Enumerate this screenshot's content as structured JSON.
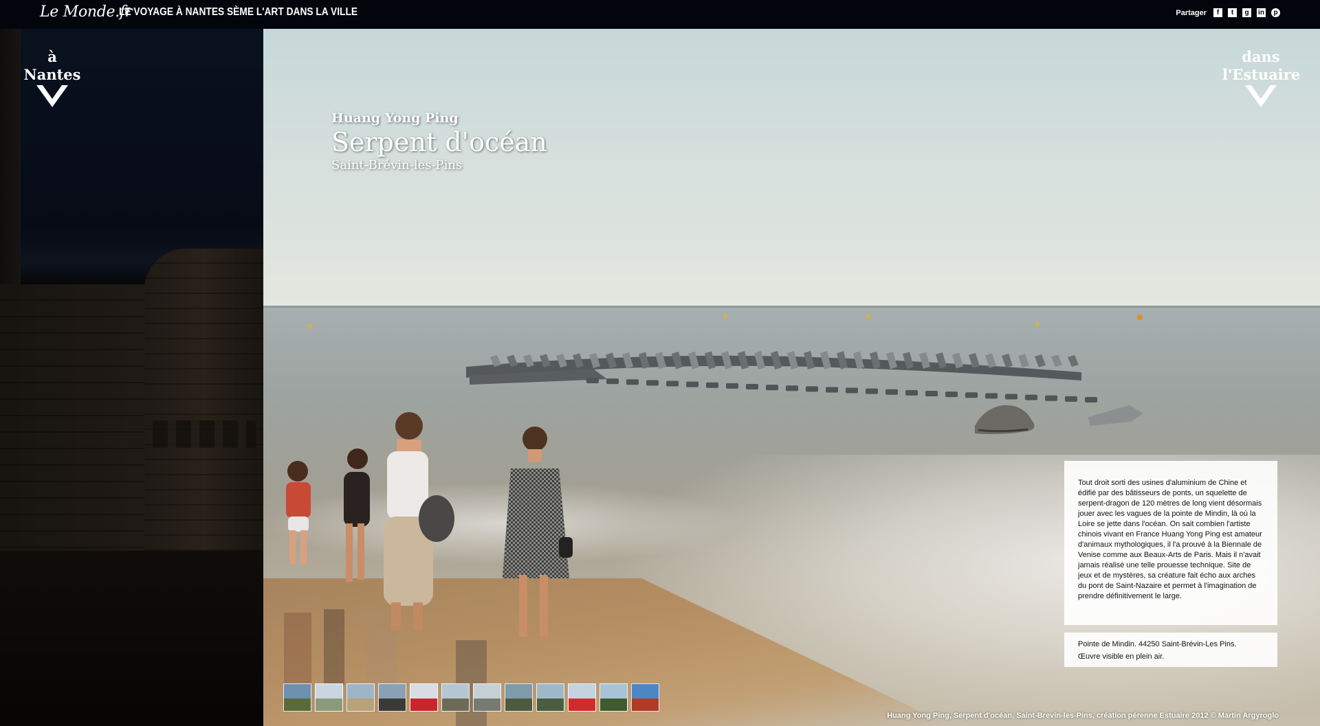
{
  "header": {
    "brand": "Le Monde.fr",
    "title": "LE VOYAGE À NANTES SÈME L'ART DANS LA VILLE",
    "share_label": "Partager",
    "share_icons": [
      "facebook-icon",
      "twitter-icon",
      "google-plus-icon",
      "linkedin-icon",
      "pinterest-icon"
    ]
  },
  "nav": {
    "left_label": "à Nantes",
    "right_label_line1": "dans",
    "right_label_line2": "l'Estuaire"
  },
  "artwork": {
    "artist": "Huang Yong Ping",
    "title": "Serpent d'océan",
    "location": "Saint-Brévin-les-Pins",
    "description": "Tout droit sorti des usines d'aluminium de Chine et édifié par des bâtisseurs de ponts, un squelette de serpent-dragon de 120 mètres de long vient désormais jouer avec les vagues de la pointe de Mindin, là où la Loire se jette dans l'océan. On sait combien l'artiste chinois vivant en France Huang Yong Ping est amateur d'animaux mythologiques, il l'a prouvé à la Biennale de Venise comme aux Beaux-Arts de Paris. Mais il n'avait jamais réalisé une telle prouesse technique. Site de jeux et de mystères, sa créature fait écho aux arches du pont de Saint-Nazaire et permet à l'imagination de prendre définitivement le large.",
    "address": "Pointe de Mindin. 44250 Saint-Brévin-Les Pins.",
    "visibility": "Œuvre visible en plein air."
  },
  "thumbnails": [
    {
      "top": "#6d8fb0",
      "bottom": "#5a6b3a"
    },
    {
      "top": "#c9d6e2",
      "bottom": "#8a9a7a"
    },
    {
      "top": "#9fb4c6",
      "bottom": "#b7a27a"
    },
    {
      "top": "#8aa0b5",
      "bottom": "#3b3a38"
    },
    {
      "top": "#d8dde2",
      "bottom": "#c9252a"
    },
    {
      "top": "#b5c6d0",
      "bottom": "#6e6a58"
    },
    {
      "top": "#c7d0d2",
      "bottom": "#777a70"
    },
    {
      "top": "#7f9aa8",
      "bottom": "#4e5a3e"
    },
    {
      "top": "#9eb7c9",
      "bottom": "#4a5d40"
    },
    {
      "top": "#c3d3df",
      "bottom": "#d22b2b"
    },
    {
      "top": "#a8c2d6",
      "bottom": "#3f5a2e"
    },
    {
      "top": "#4d86c5",
      "bottom": "#b33a24"
    }
  ],
  "photo_caption": "Huang Yong Ping, Serpent d'océan, Saint-Brevin-les-Pins, création pérenne Estuaire 2012 © Martin Argyroglo"
}
